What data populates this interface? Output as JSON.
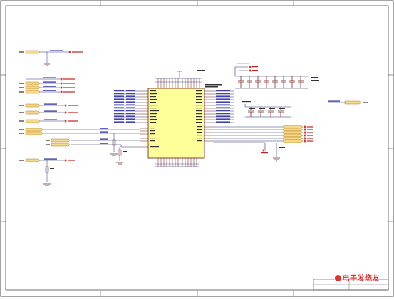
{
  "watermark": {
    "text": "电子发烧友",
    "color": "#d33333"
  },
  "colors": {
    "border": "#4a4a4a",
    "wire": "#2a2a7a",
    "chip_fill": "#ffff99",
    "chip_stroke": "#6b1212",
    "port_fill": "#f5d98a",
    "port_stroke": "#a05a00",
    "power": "#e03030",
    "label": "#1f1f9f",
    "net_red": "#c42020"
  }
}
